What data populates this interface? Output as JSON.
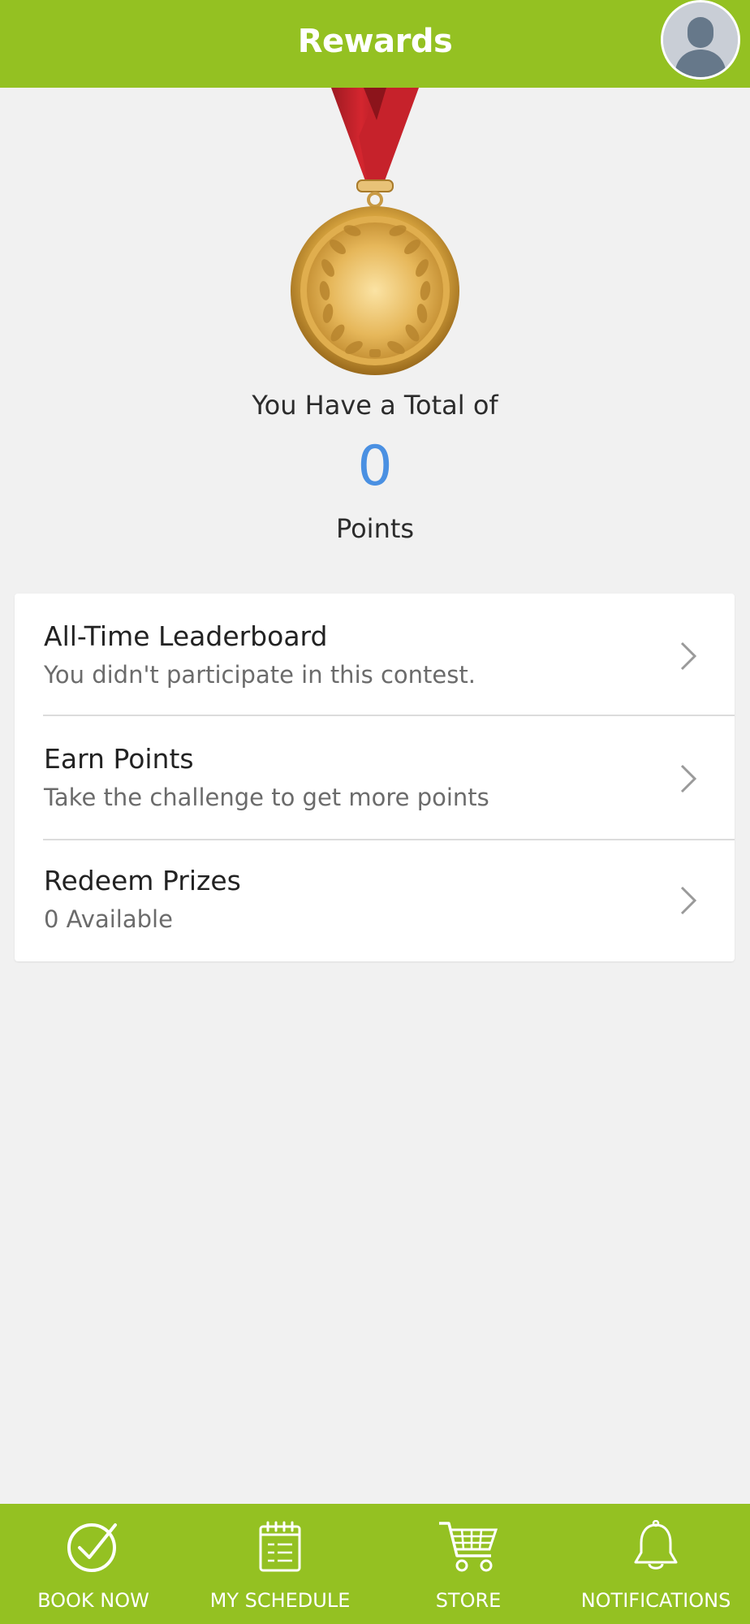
{
  "header": {
    "title": "Rewards",
    "avatar_icon": "user-avatar-icon"
  },
  "medal": {
    "icon": "gold-medal-icon"
  },
  "points": {
    "total_label": "You Have a Total of",
    "value": "0",
    "unit_label": "Points"
  },
  "menu": {
    "items": [
      {
        "title": "All-Time Leaderboard",
        "subtitle": "You didn't participate in this contest."
      },
      {
        "title": "Earn Points",
        "subtitle": "Take the challenge to get more points"
      },
      {
        "title": "Redeem Prizes",
        "subtitle": "0 Available"
      }
    ]
  },
  "bottom_nav": {
    "items": [
      {
        "label": "BOOK NOW",
        "icon": "check-circle-icon"
      },
      {
        "label": "MY SCHEDULE",
        "icon": "calendar-icon"
      },
      {
        "label": "STORE",
        "icon": "cart-icon"
      },
      {
        "label": "NOTIFICATIONS",
        "icon": "bell-icon"
      }
    ]
  },
  "colors": {
    "brand_green": "#94c122",
    "points_blue": "#4a90e2",
    "background": "#f1f1f1"
  }
}
